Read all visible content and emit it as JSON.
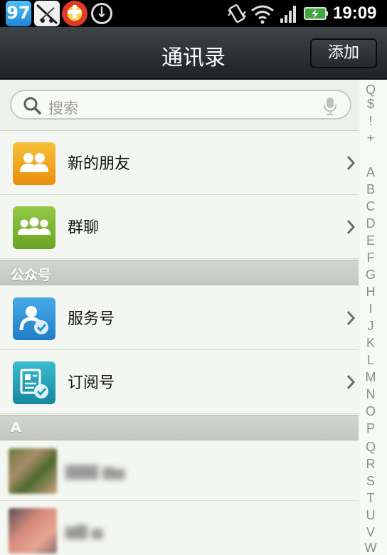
{
  "status_bar": {
    "app_icons": [
      "weather-app-icon",
      "game-app-icon",
      "plus-app-icon",
      "download-icon"
    ],
    "system_icons": [
      "vibrate-icon",
      "wifi-icon",
      "signal-icon",
      "battery-charging-icon"
    ],
    "app1_glyph": "97",
    "app3_glyph": "✚",
    "download_glyph": "↓",
    "time": "19:09"
  },
  "header": {
    "title": "通讯录",
    "add_label": "添加"
  },
  "search": {
    "placeholder": "搜索"
  },
  "rows": [
    {
      "label": "新的朋友",
      "icon": "new-friends-icon",
      "color": "#f0a010"
    },
    {
      "label": "群聊",
      "icon": "group-chat-icon",
      "color": "#7cb72c"
    },
    {
      "label": "服务号",
      "icon": "service-account-icon",
      "color": "#2b8fd4"
    },
    {
      "label": "订阅号",
      "icon": "subscription-account-icon",
      "color": "#1f9fb5"
    }
  ],
  "sections": {
    "official_accounts": "公众号",
    "contacts_a": "A"
  },
  "index_bar": {
    "letters": [
      "Q",
      "$",
      "!",
      "+",
      "A",
      "B",
      "C",
      "D",
      "E",
      "F",
      "G",
      "H",
      "I",
      "J",
      "K",
      "L",
      "M",
      "N",
      "O",
      "P",
      "Q",
      "R",
      "S",
      "T",
      "U",
      "V",
      "W"
    ]
  },
  "colors": {
    "title_bar": "#2b2f33",
    "section_header": "#c9ccc6",
    "background": "#f4f7f1"
  }
}
